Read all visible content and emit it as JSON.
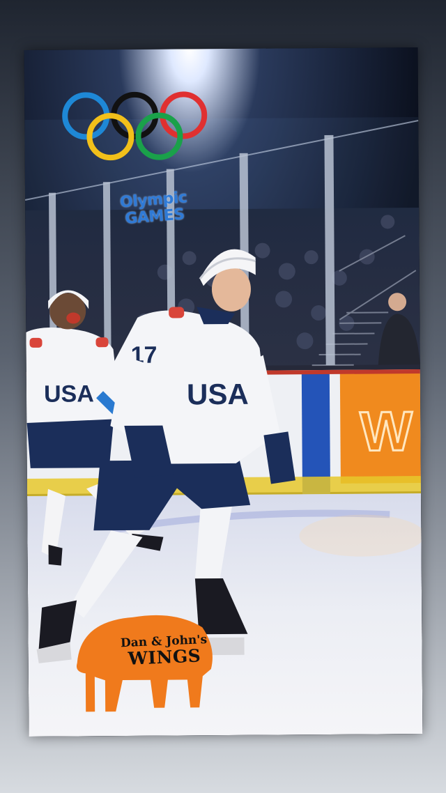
{
  "scene": {
    "caption_olympic_line1": "Olympic",
    "caption_olympic_line2": "GAMES",
    "jersey_text": "USA",
    "jersey_number": "17",
    "sponsor_line1": "Dan & John's",
    "sponsor_line2": "WINGS",
    "board_sign_partial": "W"
  },
  "colors": {
    "ring_blue": "#1e88d6",
    "ring_yellow": "#f2c01a",
    "ring_black": "#111111",
    "ring_green": "#1aa14a",
    "ring_red": "#e03030",
    "buffalo_orange": "#f07a1c",
    "jersey_navy": "#1b2e5a",
    "board_orange": "#f08a1e",
    "board_blue": "#2454b8"
  }
}
